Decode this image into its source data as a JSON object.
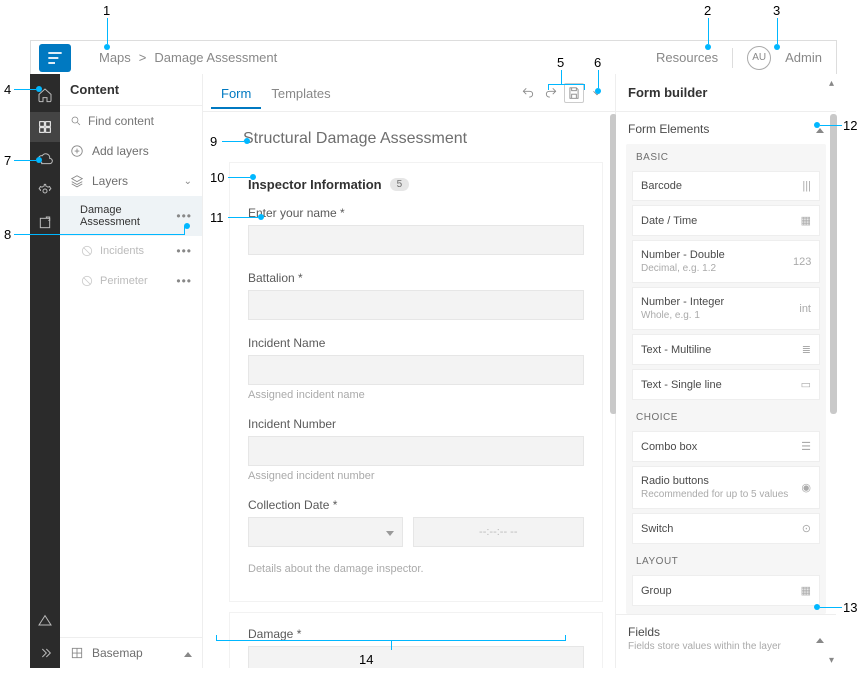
{
  "topbar": {
    "breadcrumb_root": "Maps",
    "breadcrumb_sep": ">",
    "breadcrumb_leaf": "Damage Assessment",
    "resources": "Resources",
    "avatar_initials": "AU",
    "admin": "Admin"
  },
  "content": {
    "title": "Content",
    "search_placeholder": "Find content",
    "add_layers": "Add layers",
    "layers_label": "Layers",
    "layers": [
      {
        "name": "Damage Assessment",
        "active": true
      },
      {
        "name": "Incidents",
        "disabled": true
      },
      {
        "name": "Perimeter",
        "disabled": true
      }
    ],
    "basemap": "Basemap"
  },
  "canvas": {
    "tabs": {
      "form": "Form",
      "templates": "Templates"
    },
    "form_title": "Structural Damage Assessment",
    "group": {
      "title": "Inspector Information",
      "count": "5",
      "fields": [
        {
          "label": "Enter your name *"
        },
        {
          "label": "Battalion *"
        },
        {
          "label": "Incident Name",
          "hint": "Assigned incident name"
        },
        {
          "label": "Incident Number",
          "hint": "Assigned incident number"
        },
        {
          "label": "Collection Date *",
          "datetime_placeholder": "--:--:-- --"
        }
      ],
      "helper": "Details about the damage inspector."
    },
    "next_group_label": "Damage *"
  },
  "builder": {
    "title": "Form builder",
    "form_elements": "Form Elements",
    "categories": {
      "basic": "BASIC",
      "choice": "CHOICE",
      "layout": "LAYOUT"
    },
    "elements_basic": [
      {
        "label": "Barcode",
        "glyph": "barcode"
      },
      {
        "label": "Date / Time",
        "glyph": "calendar"
      },
      {
        "label": "Number - Double",
        "sub": "Decimal, e.g. 1.2",
        "glyph": "123"
      },
      {
        "label": "Number - Integer",
        "sub": "Whole, e.g. 1",
        "glyph": "int"
      },
      {
        "label": "Text - Multiline",
        "glyph": "multiline"
      },
      {
        "label": "Text - Single line",
        "glyph": "singleline"
      }
    ],
    "elements_choice": [
      {
        "label": "Combo box",
        "glyph": "combo"
      },
      {
        "label": "Radio buttons",
        "sub": "Recommended for up to 5 values",
        "glyph": "radio"
      },
      {
        "label": "Switch",
        "glyph": "switch"
      }
    ],
    "elements_layout": [
      {
        "label": "Group",
        "glyph": "group"
      }
    ],
    "fields_title": "Fields",
    "fields_sub": "Fields store values within the layer"
  },
  "callouts": {
    "n1": "1",
    "n2": "2",
    "n3": "3",
    "n4": "4",
    "n5": "5",
    "n6": "6",
    "n7": "7",
    "n8": "8",
    "n9": "9",
    "n10": "10",
    "n11": "11",
    "n12": "12",
    "n13": "13",
    "n14": "14"
  }
}
